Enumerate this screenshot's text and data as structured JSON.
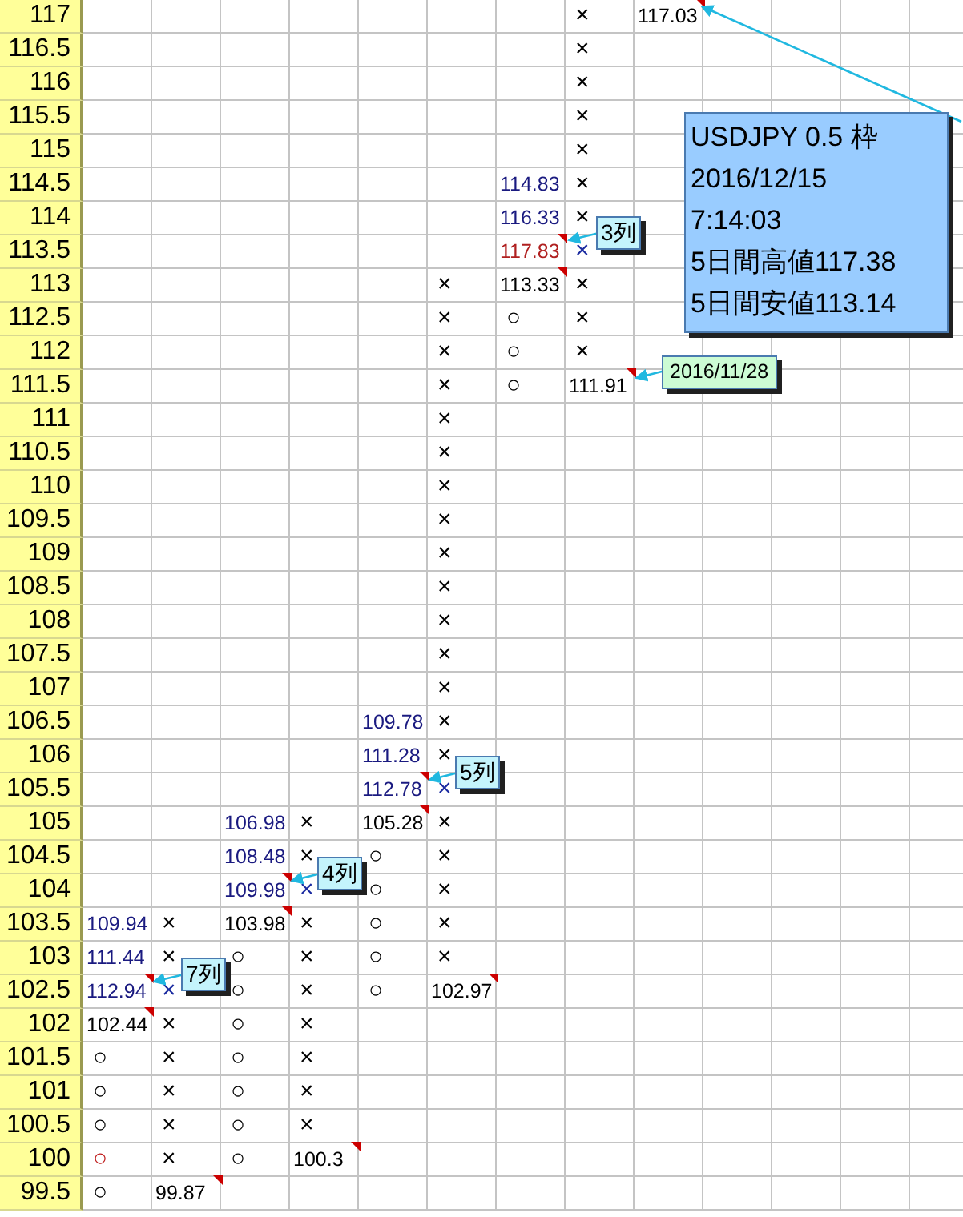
{
  "sheet": {
    "rows": [
      {
        "price": "117",
        "cells": [
          null,
          null,
          null,
          null,
          null,
          null,
          null,
          {
            "text": "×",
            "color": "#000000",
            "comment": false
          },
          {
            "text": "117.03",
            "color": "#000000",
            "comment": true
          }
        ]
      },
      {
        "price": "116.5",
        "cells": [
          null,
          null,
          null,
          null,
          null,
          null,
          null,
          {
            "text": "×",
            "color": "#000000",
            "comment": false
          }
        ]
      },
      {
        "price": "116",
        "cells": [
          null,
          null,
          null,
          null,
          null,
          null,
          null,
          {
            "text": "×",
            "color": "#000000",
            "comment": false
          }
        ]
      },
      {
        "price": "115.5",
        "cells": [
          null,
          null,
          null,
          null,
          null,
          null,
          null,
          {
            "text": "×",
            "color": "#000000",
            "comment": false
          }
        ]
      },
      {
        "price": "115",
        "cells": [
          null,
          null,
          null,
          null,
          null,
          null,
          null,
          {
            "text": "×",
            "color": "#000000",
            "comment": false
          }
        ]
      },
      {
        "price": "114.5",
        "cells": [
          null,
          null,
          null,
          null,
          null,
          null,
          {
            "text": "114.83",
            "color": "#1a1a80",
            "comment": false
          },
          {
            "text": "×",
            "color": "#000000",
            "comment": false
          }
        ]
      },
      {
        "price": "114",
        "cells": [
          null,
          null,
          null,
          null,
          null,
          null,
          {
            "text": "116.33",
            "color": "#1a1a80",
            "comment": false
          },
          {
            "text": "×",
            "color": "#000000",
            "comment": false
          }
        ]
      },
      {
        "price": "113.5",
        "cells": [
          null,
          null,
          null,
          null,
          null,
          null,
          {
            "text": "117.83",
            "color": "#b02020",
            "comment": true
          },
          {
            "text": "×",
            "color": "#1a2aa0",
            "comment": false
          }
        ]
      },
      {
        "price": "113",
        "cells": [
          null,
          null,
          null,
          null,
          null,
          {
            "text": "×",
            "color": "#000000",
            "comment": false
          },
          {
            "text": "113.33",
            "color": "#000000",
            "comment": true
          },
          {
            "text": "×",
            "color": "#000000",
            "comment": false
          }
        ]
      },
      {
        "price": "112.5",
        "cells": [
          null,
          null,
          null,
          null,
          null,
          {
            "text": "×",
            "color": "#000000",
            "comment": false
          },
          {
            "text": "○",
            "color": "#000000",
            "comment": false
          },
          {
            "text": "×",
            "color": "#000000",
            "comment": false
          }
        ]
      },
      {
        "price": "112",
        "cells": [
          null,
          null,
          null,
          null,
          null,
          {
            "text": "×",
            "color": "#000000",
            "comment": false
          },
          {
            "text": "○",
            "color": "#000000",
            "comment": false
          },
          {
            "text": "×",
            "color": "#000000",
            "comment": false
          }
        ]
      },
      {
        "price": "111.5",
        "cells": [
          null,
          null,
          null,
          null,
          null,
          {
            "text": "×",
            "color": "#000000",
            "comment": false
          },
          {
            "text": "○",
            "color": "#000000",
            "comment": false
          },
          {
            "text": "111.91",
            "color": "#000000",
            "comment": true
          }
        ]
      },
      {
        "price": "111",
        "cells": [
          null,
          null,
          null,
          null,
          null,
          {
            "text": "×",
            "color": "#000000",
            "comment": false
          }
        ]
      },
      {
        "price": "110.5",
        "cells": [
          null,
          null,
          null,
          null,
          null,
          {
            "text": "×",
            "color": "#000000",
            "comment": false
          }
        ]
      },
      {
        "price": "110",
        "cells": [
          null,
          null,
          null,
          null,
          null,
          {
            "text": "×",
            "color": "#000000",
            "comment": false
          }
        ]
      },
      {
        "price": "109.5",
        "cells": [
          null,
          null,
          null,
          null,
          null,
          {
            "text": "×",
            "color": "#000000",
            "comment": false
          }
        ]
      },
      {
        "price": "109",
        "cells": [
          null,
          null,
          null,
          null,
          null,
          {
            "text": "×",
            "color": "#000000",
            "comment": false
          }
        ]
      },
      {
        "price": "108.5",
        "cells": [
          null,
          null,
          null,
          null,
          null,
          {
            "text": "×",
            "color": "#000000",
            "comment": false
          }
        ]
      },
      {
        "price": "108",
        "cells": [
          null,
          null,
          null,
          null,
          null,
          {
            "text": "×",
            "color": "#000000",
            "comment": false
          }
        ]
      },
      {
        "price": "107.5",
        "cells": [
          null,
          null,
          null,
          null,
          null,
          {
            "text": "×",
            "color": "#000000",
            "comment": false
          }
        ]
      },
      {
        "price": "107",
        "cells": [
          null,
          null,
          null,
          null,
          null,
          {
            "text": "×",
            "color": "#000000",
            "comment": false
          }
        ]
      },
      {
        "price": "106.5",
        "cells": [
          null,
          null,
          null,
          null,
          {
            "text": "109.78",
            "color": "#1a1a80",
            "comment": false
          },
          {
            "text": "×",
            "color": "#000000",
            "comment": false
          }
        ]
      },
      {
        "price": "106",
        "cells": [
          null,
          null,
          null,
          null,
          {
            "text": "111.28",
            "color": "#1a1a80",
            "comment": false
          },
          {
            "text": "×",
            "color": "#000000",
            "comment": false
          }
        ]
      },
      {
        "price": "105.5",
        "cells": [
          null,
          null,
          null,
          null,
          {
            "text": "112.78",
            "color": "#1a1a80",
            "comment": true
          },
          {
            "text": "×",
            "color": "#1a2aa0",
            "comment": false
          }
        ]
      },
      {
        "price": "105",
        "cells": [
          null,
          null,
          {
            "text": "106.98",
            "color": "#1a1a80",
            "comment": false
          },
          {
            "text": "×",
            "color": "#000000",
            "comment": false
          },
          {
            "text": "105.28",
            "color": "#000000",
            "comment": true
          },
          {
            "text": "×",
            "color": "#000000",
            "comment": false
          }
        ]
      },
      {
        "price": "104.5",
        "cells": [
          null,
          null,
          {
            "text": "108.48",
            "color": "#1a1a80",
            "comment": false
          },
          {
            "text": "×",
            "color": "#000000",
            "comment": false
          },
          {
            "text": "○",
            "color": "#000000",
            "comment": false
          },
          {
            "text": "×",
            "color": "#000000",
            "comment": false
          }
        ]
      },
      {
        "price": "104",
        "cells": [
          null,
          null,
          {
            "text": "109.98",
            "color": "#1a1a80",
            "comment": true
          },
          {
            "text": "×",
            "color": "#1a2aa0",
            "comment": false
          },
          {
            "text": "○",
            "color": "#000000",
            "comment": false
          },
          {
            "text": "×",
            "color": "#000000",
            "comment": false
          }
        ]
      },
      {
        "price": "103.5",
        "cells": [
          {
            "text": "109.94",
            "color": "#1a1a80",
            "comment": false
          },
          {
            "text": "×",
            "color": "#000000",
            "comment": false
          },
          {
            "text": "103.98",
            "color": "#000000",
            "comment": true
          },
          {
            "text": "×",
            "color": "#000000",
            "comment": false
          },
          {
            "text": "○",
            "color": "#000000",
            "comment": false
          },
          {
            "text": "×",
            "color": "#000000",
            "comment": false
          }
        ]
      },
      {
        "price": "103",
        "cells": [
          {
            "text": "111.44",
            "color": "#1a1a80",
            "comment": false
          },
          {
            "text": "×",
            "color": "#000000",
            "comment": false
          },
          {
            "text": "○",
            "color": "#000000",
            "comment": false
          },
          {
            "text": "×",
            "color": "#000000",
            "comment": false
          },
          {
            "text": "○",
            "color": "#000000",
            "comment": false
          },
          {
            "text": "×",
            "color": "#000000",
            "comment": false
          }
        ]
      },
      {
        "price": "102.5",
        "cells": [
          {
            "text": "112.94",
            "color": "#1a1a80",
            "comment": true
          },
          {
            "text": "×",
            "color": "#1a2aa0",
            "comment": false
          },
          {
            "text": "○",
            "color": "#000000",
            "comment": false
          },
          {
            "text": "×",
            "color": "#000000",
            "comment": false
          },
          {
            "text": "○",
            "color": "#000000",
            "comment": false
          },
          {
            "text": "102.97",
            "color": "#000000",
            "comment": true
          }
        ]
      },
      {
        "price": "102",
        "cells": [
          {
            "text": "102.44",
            "color": "#000000",
            "comment": true
          },
          {
            "text": "×",
            "color": "#000000",
            "comment": false
          },
          {
            "text": "○",
            "color": "#000000",
            "comment": false
          },
          {
            "text": "×",
            "color": "#000000",
            "comment": false
          }
        ]
      },
      {
        "price": "101.5",
        "cells": [
          {
            "text": "○",
            "color": "#000000",
            "comment": false
          },
          {
            "text": "×",
            "color": "#000000",
            "comment": false
          },
          {
            "text": "○",
            "color": "#000000",
            "comment": false
          },
          {
            "text": "×",
            "color": "#000000",
            "comment": false
          }
        ]
      },
      {
        "price": "101",
        "cells": [
          {
            "text": "○",
            "color": "#000000",
            "comment": false
          },
          {
            "text": "×",
            "color": "#000000",
            "comment": false
          },
          {
            "text": "○",
            "color": "#000000",
            "comment": false
          },
          {
            "text": "×",
            "color": "#000000",
            "comment": false
          }
        ]
      },
      {
        "price": "100.5",
        "cells": [
          {
            "text": "○",
            "color": "#000000",
            "comment": false
          },
          {
            "text": "×",
            "color": "#000000",
            "comment": false
          },
          {
            "text": "○",
            "color": "#000000",
            "comment": false
          },
          {
            "text": "×",
            "color": "#000000",
            "comment": false
          }
        ]
      },
      {
        "price": "100",
        "cells": [
          {
            "text": "○",
            "color": "#c02020",
            "comment": false
          },
          {
            "text": "×",
            "color": "#000000",
            "comment": false
          },
          {
            "text": "○",
            "color": "#000000",
            "comment": false
          },
          {
            "text": "100.3",
            "color": "#000000",
            "comment": true
          }
        ]
      },
      {
        "price": "99.5",
        "cells": [
          {
            "text": "○",
            "color": "#000000",
            "comment": false
          },
          {
            "text": "99.87",
            "color": "#000000",
            "comment": true
          }
        ]
      }
    ]
  },
  "callouts": [
    {
      "kind": "tag",
      "text": "3列"
    },
    {
      "kind": "tag",
      "text": "5列"
    },
    {
      "kind": "tag",
      "text": "4列"
    },
    {
      "kind": "tag",
      "text": "7列"
    },
    {
      "kind": "date",
      "text": "2016/11/28"
    },
    {
      "kind": "info",
      "lines": [
        "USDJPY 0.5 枠",
        "2016/12/15",
        "7:14:03",
        "5日間高値117.38",
        "5日間安値113.14"
      ]
    }
  ]
}
